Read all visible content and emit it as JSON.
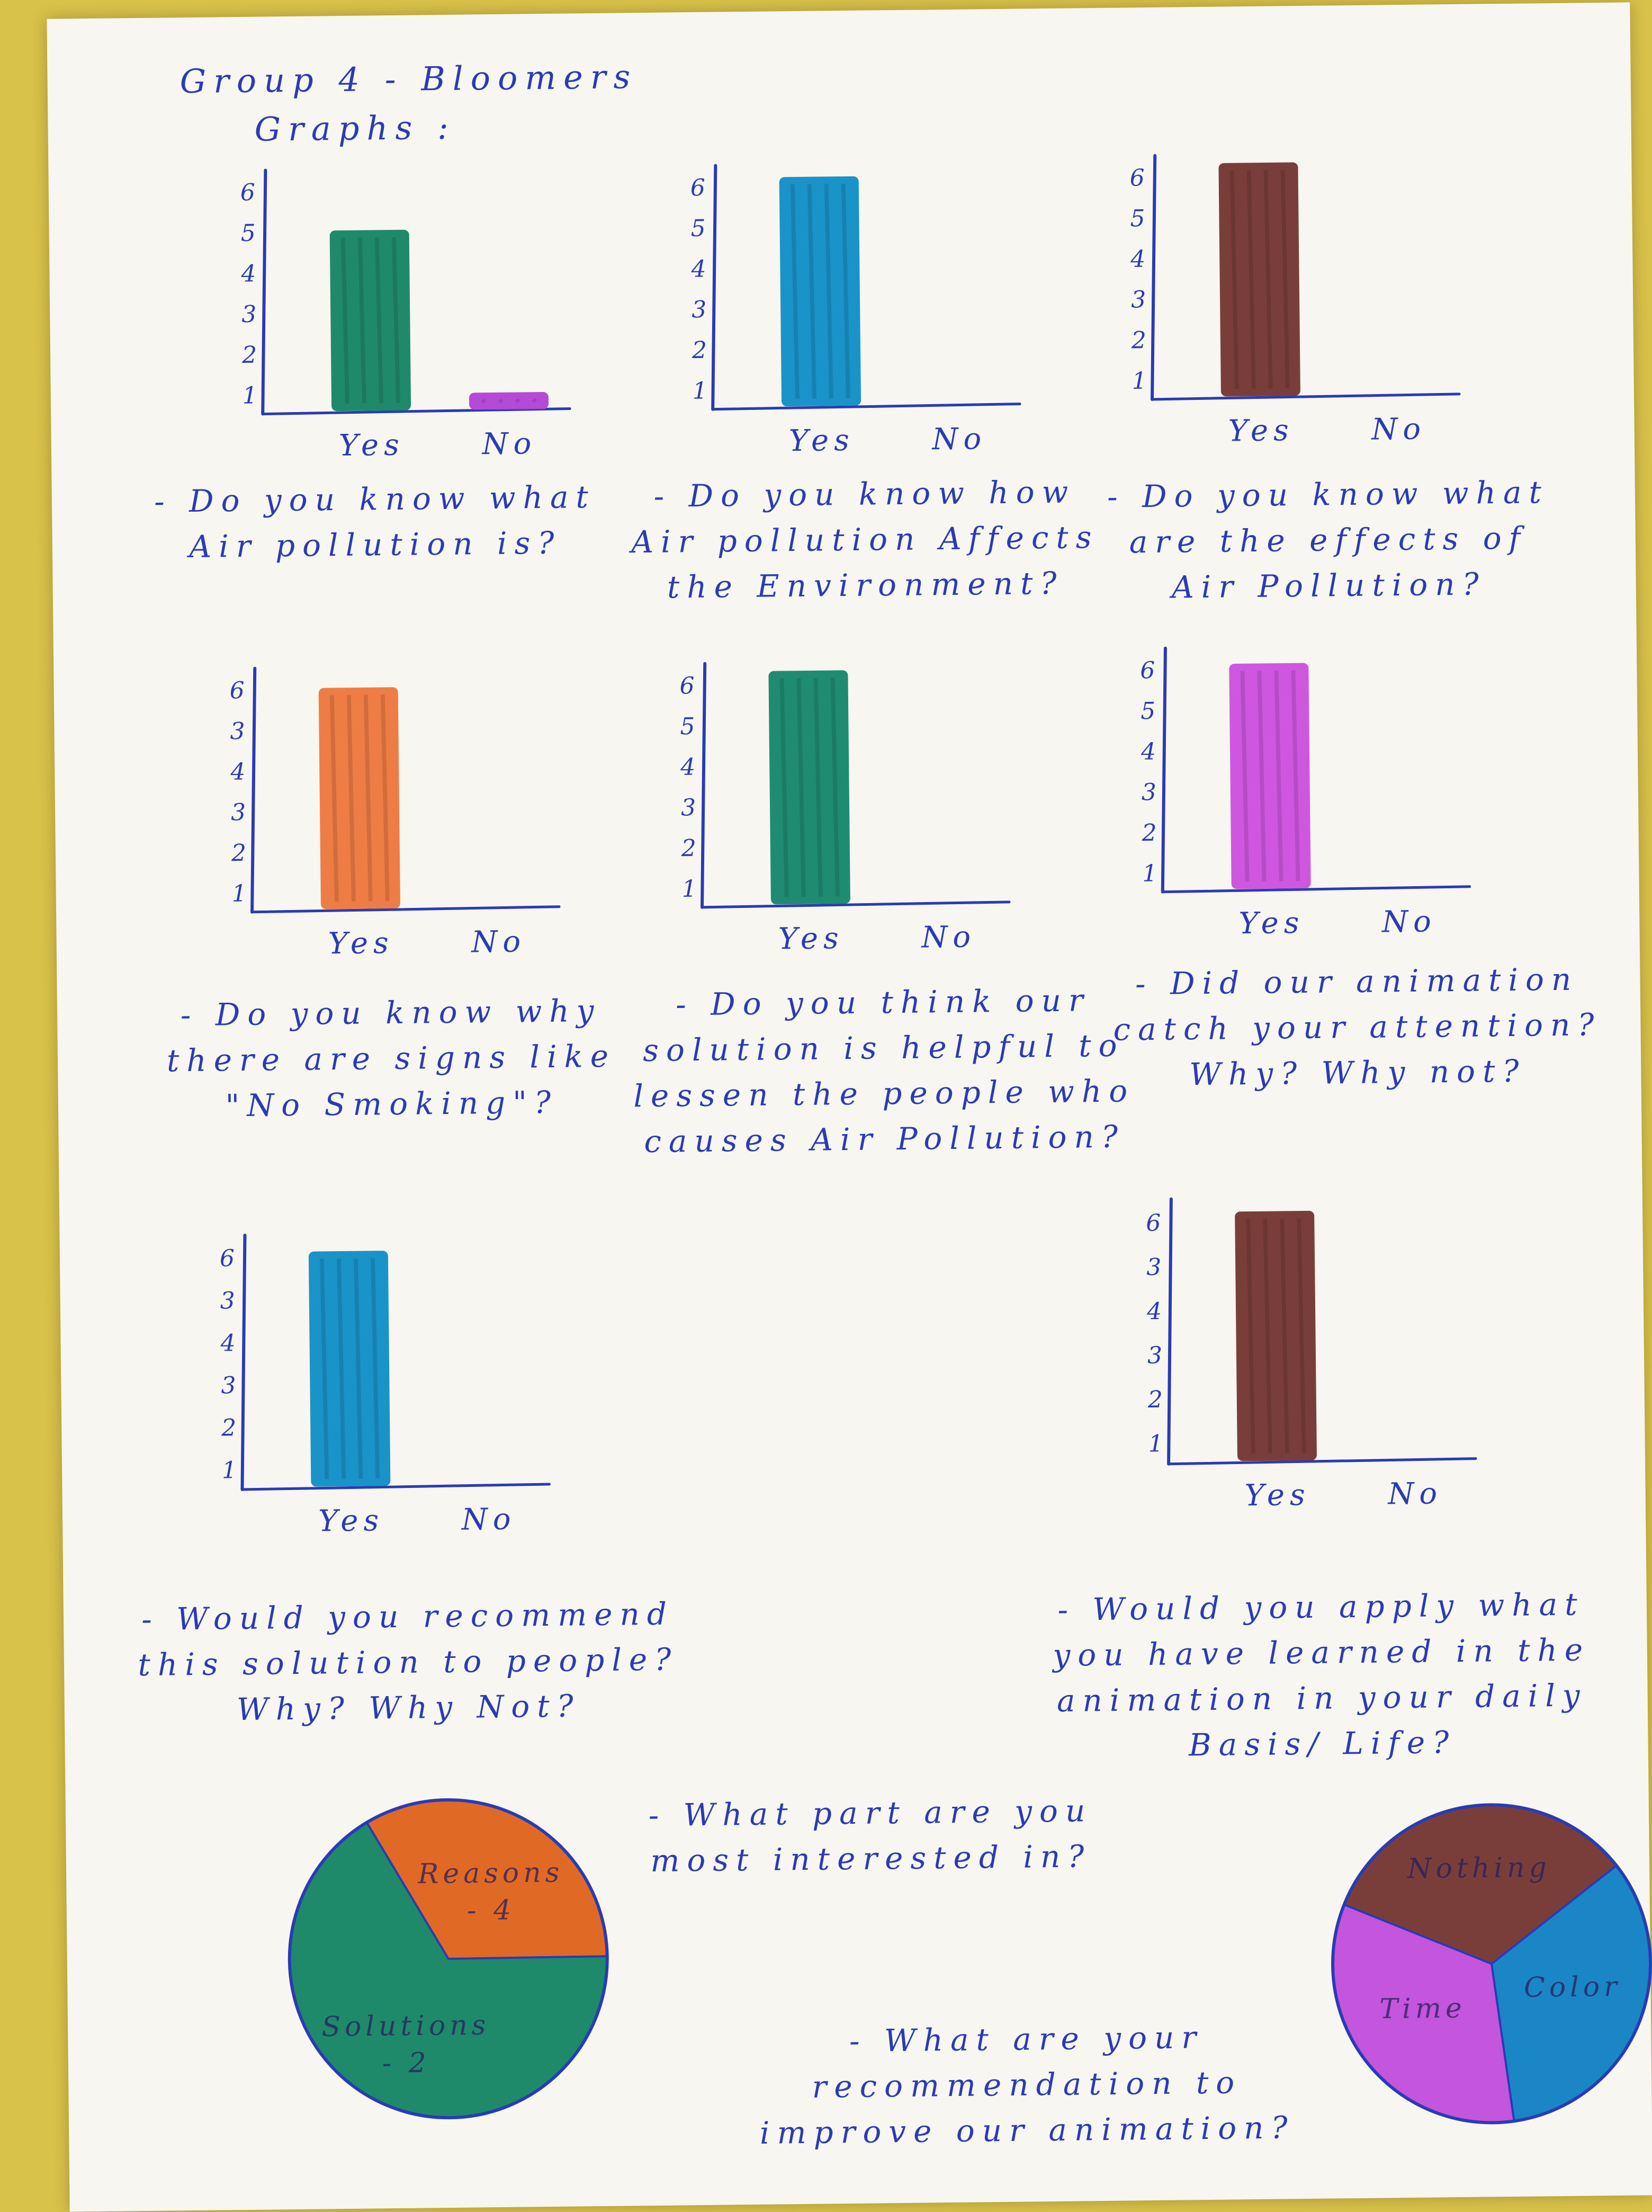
{
  "header": {
    "line1": "Group 4 - Bloomers",
    "line2": "Graphs :"
  },
  "colors": {
    "ink": "#2a3bb5",
    "green": "#1f8a6a",
    "teal": "#1f8c72",
    "blue": "#1a93c9",
    "brown": "#7a3e3a",
    "orange": "#ee7d45",
    "pink": "#cf57e0",
    "violet": "#b64ad8",
    "pie_orange": "#e06a25",
    "pie_green": "#1e8a6a",
    "pie_blue": "#1a86c6",
    "pie_pink": "#c455dd"
  },
  "chart_data": [
    {
      "type": "bar",
      "categories": [
        "Yes",
        "No"
      ],
      "values": [
        5,
        0.5
      ],
      "yticks": [
        "1",
        "2",
        "3",
        "4",
        "5",
        "6"
      ],
      "ylim": [
        1,
        6.5
      ],
      "color": "green",
      "no_color": "violet",
      "question": "- Do you know what Air pollution is?"
    },
    {
      "type": "bar",
      "categories": [
        "Yes",
        "No"
      ],
      "values": [
        6.2,
        0
      ],
      "yticks": [
        "1",
        "2",
        "3",
        "4",
        "5",
        "6"
      ],
      "ylim": [
        1,
        6.5
      ],
      "color": "blue",
      "question": "- Do you know how Air pollution Affects the Environment?"
    },
    {
      "type": "bar",
      "categories": [
        "Yes",
        "No"
      ],
      "values": [
        6.3,
        0
      ],
      "yticks": [
        "1",
        "2",
        "3",
        "4",
        "5",
        "6"
      ],
      "ylim": [
        1,
        6.5
      ],
      "color": "brown",
      "question": "- Do you know what are the effects of Air Pollution?"
    },
    {
      "type": "bar",
      "categories": [
        "Yes",
        "No"
      ],
      "values": [
        6,
        0
      ],
      "yticks": [
        "1",
        "2",
        "3",
        "4",
        "3",
        "6"
      ],
      "ylim": [
        1,
        6.5
      ],
      "color": "orange",
      "question": "- Do you know why there are signs like \"No Smoking\"?"
    },
    {
      "type": "bar",
      "categories": [
        "Yes",
        "No"
      ],
      "values": [
        6.3,
        0
      ],
      "yticks": [
        "1",
        "2",
        "3",
        "4",
        "5",
        "6"
      ],
      "ylim": [
        1,
        6.5
      ],
      "color": "teal",
      "question": "- Do you think our solution is helpful to lessen the people who causes Air Pollution?"
    },
    {
      "type": "bar",
      "categories": [
        "Yes",
        "No"
      ],
      "values": [
        6.1,
        0
      ],
      "yticks": [
        "1",
        "2",
        "3",
        "4",
        "5",
        "6"
      ],
      "ylim": [
        1,
        6.5
      ],
      "color": "pink",
      "question": "- Did our animation catch your attention? Why? Why not?"
    },
    {
      "type": "bar",
      "categories": [
        "Yes",
        "No"
      ],
      "values": [
        6.1,
        0
      ],
      "yticks": [
        "1",
        "2",
        "3",
        "4",
        "3",
        "6"
      ],
      "ylim": [
        1,
        6.5
      ],
      "color": "blue",
      "question": "- Would you recommend this solution to people? Why? Why Not?"
    },
    {
      "type": "bar",
      "categories": [
        "Yes",
        "No"
      ],
      "values": [
        6.2,
        0
      ],
      "yticks": [
        "1",
        "2",
        "3",
        "4",
        "3",
        "6"
      ],
      "ylim": [
        1,
        6.5
      ],
      "color": "brown",
      "question": "- Would you apply what you have learned in the animation in your daily Basis/ Life?"
    },
    {
      "type": "pie",
      "slices": [
        {
          "label": "Reasons - 4",
          "value": 4,
          "color": "pie_orange"
        },
        {
          "label": "Solutions - 2",
          "value": 8,
          "color": "pie_green"
        }
      ],
      "question": "- What part are you most interested in?"
    },
    {
      "type": "pie",
      "slices": [
        {
          "label": "Nothing",
          "value": 4,
          "color": "brown"
        },
        {
          "label": "Color",
          "value": 4,
          "color": "pie_blue"
        },
        {
          "label": "Time",
          "value": 4,
          "color": "pie_pink"
        }
      ],
      "question": "- What are your recommendation to improve our animation?"
    }
  ]
}
